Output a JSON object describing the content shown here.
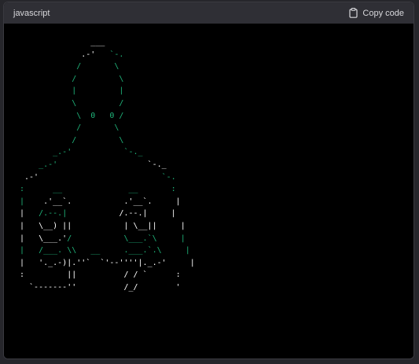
{
  "header": {
    "language": "javascript",
    "copy_label": "Copy code",
    "copy_icon": "clipboard-icon"
  },
  "colors": {
    "background": "#000000",
    "header_bg": "#2f2f35",
    "text_white": "#ffffff",
    "text_green": "#1fb47a"
  },
  "code_lines": [
    [
      {
        "t": "               ___",
        "c": "w"
      }
    ],
    [
      {
        "t": "             .-'",
        "c": "w"
      },
      {
        "t": "   `-.",
        "c": "g"
      }
    ],
    [
      {
        "t": "            /       \\",
        "c": "g"
      }
    ],
    [
      {
        "t": "           /         \\",
        "c": "g"
      }
    ],
    [
      {
        "t": "           |         |",
        "c": "g"
      }
    ],
    [
      {
        "t": "           \\         /",
        "c": "g"
      }
    ],
    [
      {
        "t": "            \\  0   0 /",
        "c": "g"
      }
    ],
    [
      {
        "t": "            /       \\",
        "c": "g"
      }
    ],
    [
      {
        "t": "           /         \\",
        "c": "g"
      }
    ],
    [
      {
        "t": "       _.-'           `-._",
        "c": "g"
      }
    ],
    [
      {
        "t": "    _.-'",
        "c": "g"
      },
      {
        "t": "                   `-._",
        "c": "w"
      }
    ],
    [
      {
        "t": " .-'",
        "c": "w"
      },
      {
        "t": "                          `-.",
        "c": "g"
      }
    ],
    [
      {
        "t": ":      __              __       :",
        "c": "g"
      }
    ],
    [
      {
        "t": "|    ",
        "c": "g"
      },
      {
        "t": ".'__`.           .'__`.     |",
        "c": "w"
      }
    ],
    [
      {
        "t": "|   ",
        "c": "w"
      },
      {
        "t": "/.--.|",
        "c": "g"
      },
      {
        "t": "           /.--.|     |",
        "c": "w"
      }
    ],
    [
      {
        "t": "|   \\__) ||           | \\__||     |",
        "c": "w"
      }
    ],
    [
      {
        "t": "|   \\___.'",
        "c": "w"
      },
      {
        "t": "/           \\___.`\\     |",
        "c": "g"
      }
    ],
    [
      {
        "t": "|   ",
        "c": "g"
      },
      {
        "t": "/___. \\\\   __     .___.`.\\     |",
        "c": "g"
      }
    ],
    [
      {
        "t": "|   ",
        "c": "w"
      },
      {
        "t": "'._.-)|.''`  `'--''''|._.-'     |",
        "c": "w"
      }
    ],
    [
      {
        "t": ":         ||          / / `      :",
        "c": "w"
      }
    ],
    [
      {
        "t": "  `-------''          /_/        '",
        "c": "w"
      }
    ]
  ]
}
